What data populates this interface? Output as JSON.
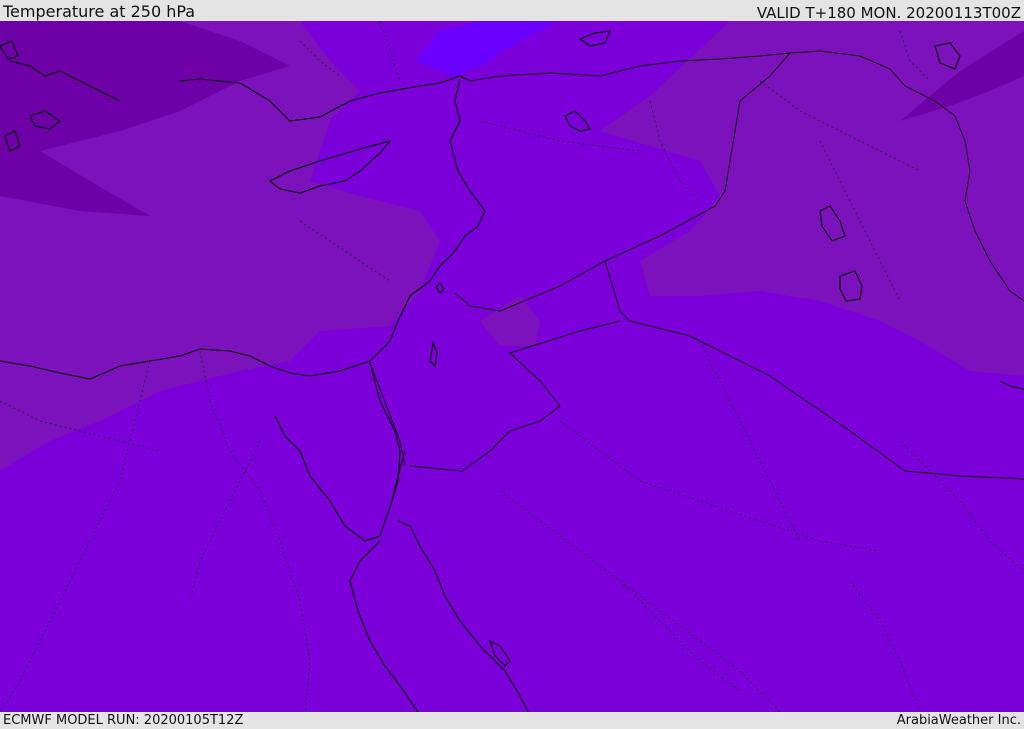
{
  "header": {
    "title": "Temperature at 250 hPa",
    "valid": "VALID T+180 MON. 20200113T00Z"
  },
  "footer": {
    "model_run": "ECMWF MODEL RUN: 20200105T12Z",
    "credit": "ArabiaWeather Inc."
  },
  "map": {
    "field": "temperature",
    "level": "250 hPa",
    "colors": {
      "base": "#7b00d9",
      "warm_band": "#7c12bb",
      "cold_core": "#6d00a6",
      "bright_patch": "#6a00ff",
      "mid_patch": "#7508cf",
      "coastline": "#000000",
      "border": "#111111"
    },
    "layers": [
      "temperature-shading",
      "coastlines",
      "country-borders",
      "province-borders"
    ]
  }
}
